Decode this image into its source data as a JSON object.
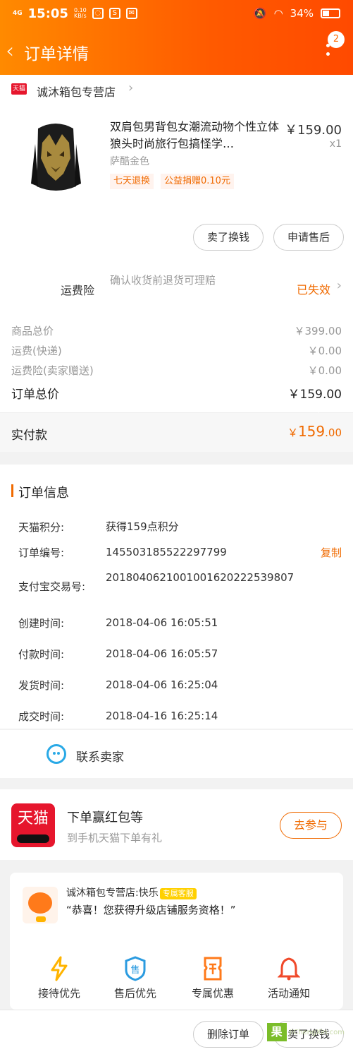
{
  "status_bar": {
    "time": "15:05",
    "net": "4G",
    "speed": "0.10",
    "speed_unit": "KB/s",
    "battery": "34%"
  },
  "header": {
    "title": "订单详情",
    "badge_count": "2"
  },
  "store": {
    "platform_tag": "天猫",
    "name": "诚沐箱包专营店"
  },
  "product": {
    "name": "双肩包男背包女潮流动物个性立体狼头时尚旅行包搞怪学…",
    "price": "￥159.00",
    "qty": "x1",
    "spec": "萨酷金色",
    "tags": [
      "七天退换",
      "公益捐赠0.10元"
    ],
    "buttons": [
      "卖了换钱",
      "申请售后"
    ]
  },
  "insurance": {
    "label": "运费险",
    "desc": "确认收货前退货可理赔",
    "status": "已失效"
  },
  "costs": [
    {
      "label": "商品总价",
      "value": "￥399.00"
    },
    {
      "label": "运费(快递)",
      "value": "￥0.00"
    },
    {
      "label": "运费险(卖家赠送)",
      "value": "￥0.00"
    }
  ],
  "order_total": {
    "label": "订单总价",
    "value": "￥159.00"
  },
  "paid": {
    "label": "实付款",
    "currency": "￥",
    "int": "159",
    "dec": ".00"
  },
  "order_info": {
    "title": "订单信息",
    "copy_label": "复制",
    "rows": [
      {
        "k": "天猫积分:",
        "v": "获得159点积分"
      },
      {
        "k": "订单编号:",
        "v": "145503185522297799"
      },
      {
        "k": "支付宝交易号:",
        "v": "2018040621001001620222539807"
      },
      {
        "k": "创建时间:",
        "v": "2018-04-06 16:05:51"
      },
      {
        "k": "付款时间:",
        "v": "2018-04-06 16:05:57"
      },
      {
        "k": "发货时间:",
        "v": "2018-04-06 16:25:04"
      },
      {
        "k": "成交时间:",
        "v": "2018-04-16 16:25:14"
      }
    ]
  },
  "contact": {
    "label": "联系卖家"
  },
  "promo": {
    "logo": "天猫",
    "title": "下单赢红包等",
    "subtitle": "到手机天猫下单有礼",
    "button": "去参与"
  },
  "service": {
    "name": "诚沐箱包专营店:快乐",
    "tag": "专属客服",
    "quote": "“恭喜！您获得升级店铺服务资格！”",
    "items": [
      "接待优先",
      "售后优先",
      "专属优惠",
      "活动通知"
    ],
    "after_sale_glyph": "售"
  },
  "bottom": {
    "buttons": [
      "删除订单",
      "卖了换钱"
    ],
    "watermark_logo": "果",
    "watermark_text": "JiChengXin.com"
  },
  "colors": {
    "accent": "#f06a00",
    "header_start": "#ff8a00",
    "header_end": "#ff4a00",
    "tmall_red": "#e6162d"
  }
}
